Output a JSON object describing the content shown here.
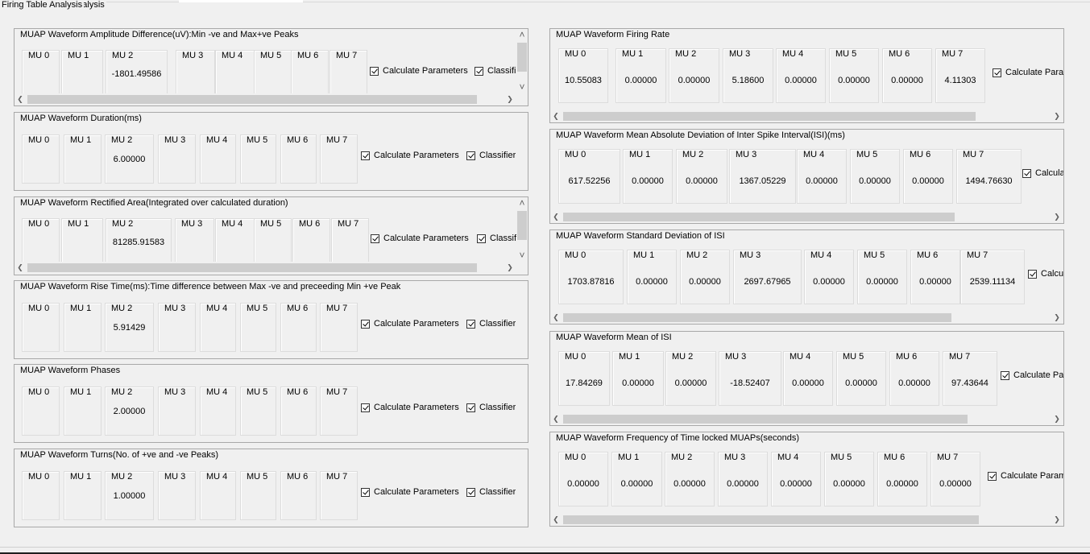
{
  "window_tabs": [],
  "left_group": {
    "title": "MUAP Waveform Analysis",
    "panels": [
      {
        "title": "MUAP Waveform Amplitude Difference(uV):Min -ve and Max+ve Peaks",
        "mu": [
          {
            "label": "MU 0",
            "value": ""
          },
          {
            "label": "MU 1",
            "value": ""
          },
          {
            "label": "MU 2",
            "value": "-1801.49586"
          },
          {
            "label": "MU 3",
            "value": ""
          },
          {
            "label": "MU 4",
            "value": ""
          },
          {
            "label": "MU 5",
            "value": ""
          },
          {
            "label": "MU 6",
            "value": ""
          },
          {
            "label": "MU 7",
            "value": ""
          }
        ],
        "calc_label": "Calculate Parameters",
        "classifier_label": "Classifier"
      },
      {
        "title": "MUAP Waveform Duration(ms)",
        "mu": [
          {
            "label": "MU 0",
            "value": ""
          },
          {
            "label": "MU 1",
            "value": ""
          },
          {
            "label": "MU 2",
            "value": "6.00000"
          },
          {
            "label": "MU 3",
            "value": ""
          },
          {
            "label": "MU 4",
            "value": ""
          },
          {
            "label": "MU 5",
            "value": ""
          },
          {
            "label": "MU 6",
            "value": ""
          },
          {
            "label": "MU 7",
            "value": ""
          }
        ],
        "calc_label": "Calculate Parameters",
        "classifier_label": "Classifier"
      },
      {
        "title": "MUAP Waveform Rectified Area(Integrated over calculated duration)",
        "mu": [
          {
            "label": "MU 0",
            "value": ""
          },
          {
            "label": "MU 1",
            "value": ""
          },
          {
            "label": "MU 2",
            "value": "81285.91583"
          },
          {
            "label": "MU 3",
            "value": ""
          },
          {
            "label": "MU 4",
            "value": ""
          },
          {
            "label": "MU 5",
            "value": ""
          },
          {
            "label": "MU 6",
            "value": ""
          },
          {
            "label": "MU 7",
            "value": ""
          }
        ],
        "calc_label": "Calculate Parameters",
        "classifier_label": "Classifier"
      },
      {
        "title": "MUAP Waveform Rise Time(ms):Time difference between Max -ve and preceeding Min +ve Peak",
        "mu": [
          {
            "label": "MU 0",
            "value": ""
          },
          {
            "label": "MU 1",
            "value": ""
          },
          {
            "label": "MU 2",
            "value": "5.91429"
          },
          {
            "label": "MU 3",
            "value": ""
          },
          {
            "label": "MU 4",
            "value": ""
          },
          {
            "label": "MU 5",
            "value": ""
          },
          {
            "label": "MU 6",
            "value": ""
          },
          {
            "label": "MU 7",
            "value": ""
          }
        ],
        "calc_label": "Calculate Parameters",
        "classifier_label": "Classifier"
      },
      {
        "title": "MUAP Waveform Phases",
        "mu": [
          {
            "label": "MU 0",
            "value": ""
          },
          {
            "label": "MU 1",
            "value": ""
          },
          {
            "label": "MU 2",
            "value": "2.00000"
          },
          {
            "label": "MU 3",
            "value": ""
          },
          {
            "label": "MU 4",
            "value": ""
          },
          {
            "label": "MU 5",
            "value": ""
          },
          {
            "label": "MU 6",
            "value": ""
          },
          {
            "label": "MU 7",
            "value": ""
          }
        ],
        "calc_label": "Calculate Parameters",
        "classifier_label": "Classifier"
      },
      {
        "title": "MUAP Waveform Turns(No. of +ve and -ve Peaks)",
        "mu": [
          {
            "label": "MU 0",
            "value": ""
          },
          {
            "label": "MU 1",
            "value": ""
          },
          {
            "label": "MU 2",
            "value": "1.00000"
          },
          {
            "label": "MU 3",
            "value": ""
          },
          {
            "label": "MU 4",
            "value": ""
          },
          {
            "label": "MU 5",
            "value": ""
          },
          {
            "label": "MU 6",
            "value": ""
          },
          {
            "label": "MU 7",
            "value": ""
          }
        ],
        "calc_label": "Calculate Parameters",
        "classifier_label": "Classifier"
      }
    ]
  },
  "right_group": {
    "title": "Firing Table Analysis",
    "panels": [
      {
        "title": "MUAP Waveform Firing Rate",
        "mu": [
          {
            "label": "MU 0",
            "value": "10.55083"
          },
          {
            "label": "MU 1",
            "value": "0.00000"
          },
          {
            "label": "MU 2",
            "value": "0.00000"
          },
          {
            "label": "MU 3",
            "value": "5.18600"
          },
          {
            "label": "MU 4",
            "value": "0.00000"
          },
          {
            "label": "MU 5",
            "value": "0.00000"
          },
          {
            "label": "MU 6",
            "value": "0.00000"
          },
          {
            "label": "MU 7",
            "value": "4.11303"
          }
        ],
        "calc_label": "Calculate Parameters"
      },
      {
        "title": "MUAP Waveform Mean Absolute Deviation of Inter Spike Interval(ISI)(ms)",
        "mu": [
          {
            "label": "MU 0",
            "value": "617.52256"
          },
          {
            "label": "MU 1",
            "value": "0.00000"
          },
          {
            "label": "MU 2",
            "value": "0.00000"
          },
          {
            "label": "MU 3",
            "value": "1367.05229"
          },
          {
            "label": "MU 4",
            "value": "0.00000"
          },
          {
            "label": "MU 5",
            "value": "0.00000"
          },
          {
            "label": "MU 6",
            "value": "0.00000"
          },
          {
            "label": "MU 7",
            "value": "1494.76630"
          }
        ],
        "calc_label": "Calculate Parameters"
      },
      {
        "title": "MUAP Waveform Standard Deviation of ISI",
        "mu": [
          {
            "label": "MU 0",
            "value": "1703.87816"
          },
          {
            "label": "MU 1",
            "value": "0.00000"
          },
          {
            "label": "MU 2",
            "value": "0.00000"
          },
          {
            "label": "MU 3",
            "value": "2697.67965"
          },
          {
            "label": "MU 4",
            "value": "0.00000"
          },
          {
            "label": "MU 5",
            "value": "0.00000"
          },
          {
            "label": "MU 6",
            "value": "0.00000"
          },
          {
            "label": "MU 7",
            "value": "2539.11134"
          }
        ],
        "calc_label": "Calculate Parameters"
      },
      {
        "title": "MUAP Waveform Mean of ISI",
        "mu": [
          {
            "label": "MU 0",
            "value": "17.84269"
          },
          {
            "label": "MU 1",
            "value": "0.00000"
          },
          {
            "label": "MU 2",
            "value": "0.00000"
          },
          {
            "label": "MU 3",
            "value": "-18.52407"
          },
          {
            "label": "MU 4",
            "value": "0.00000"
          },
          {
            "label": "MU 5",
            "value": "0.00000"
          },
          {
            "label": "MU 6",
            "value": "0.00000"
          },
          {
            "label": "MU 7",
            "value": "97.43644"
          }
        ],
        "calc_label": "Calculate Parameters"
      },
      {
        "title": "MUAP Waveform Frequency of Time locked MUAPs(seconds)",
        "mu": [
          {
            "label": "MU 0",
            "value": "0.00000"
          },
          {
            "label": "MU 1",
            "value": "0.00000"
          },
          {
            "label": "MU 2",
            "value": "0.00000"
          },
          {
            "label": "MU 3",
            "value": "0.00000"
          },
          {
            "label": "MU 4",
            "value": "0.00000"
          },
          {
            "label": "MU 5",
            "value": "0.00000"
          },
          {
            "label": "MU 6",
            "value": "0.00000"
          },
          {
            "label": "MU 7",
            "value": "0.00000"
          }
        ],
        "calc_label": "Calculate Parameters"
      }
    ]
  }
}
